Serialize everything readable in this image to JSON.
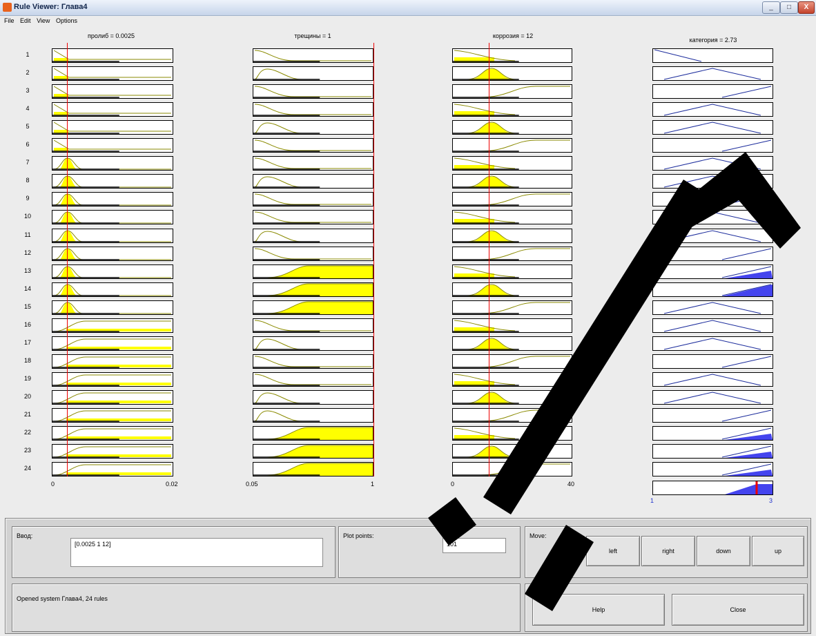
{
  "window": {
    "title": "Rule Viewer: Глава4",
    "minimize_icon": "minimize-icon",
    "maximize_icon": "maximize-icon",
    "close_label": "X"
  },
  "menu": [
    "File",
    "Edit",
    "View",
    "Options"
  ],
  "columns": [
    {
      "header": "пролиб = 0.0025",
      "min": "0",
      "max": "0.02"
    },
    {
      "header": "трещины = 1",
      "min": "0.05",
      "max": "1"
    },
    {
      "header": "коррозия = 12",
      "min": "0",
      "max": "40"
    },
    {
      "header": "категория = 2.73",
      "min": "1",
      "max": "3"
    }
  ],
  "rules": [
    "1",
    "2",
    "3",
    "4",
    "5",
    "6",
    "7",
    "8",
    "9",
    "10",
    "11",
    "12",
    "13",
    "14",
    "15",
    "16",
    "17",
    "18",
    "19",
    "20",
    "21",
    "22",
    "23",
    "24"
  ],
  "input_panel": {
    "label": "Ввод:",
    "value": "[0.0025 1 12]"
  },
  "plot_points": {
    "label": "Plot points:",
    "value": "101"
  },
  "move_panel": {
    "label": "Move:",
    "buttons": [
      "left",
      "right",
      "down",
      "up"
    ]
  },
  "status": "Opened system Глава4, 24 rules",
  "help_label": "Help",
  "close_button_label": "Close",
  "colors": {
    "fill": "#ffff00",
    "curve": "#8a8a00",
    "output_line": "#1c2c9c",
    "output_fill": "#4444ee",
    "indicator": "#ee0000"
  }
}
